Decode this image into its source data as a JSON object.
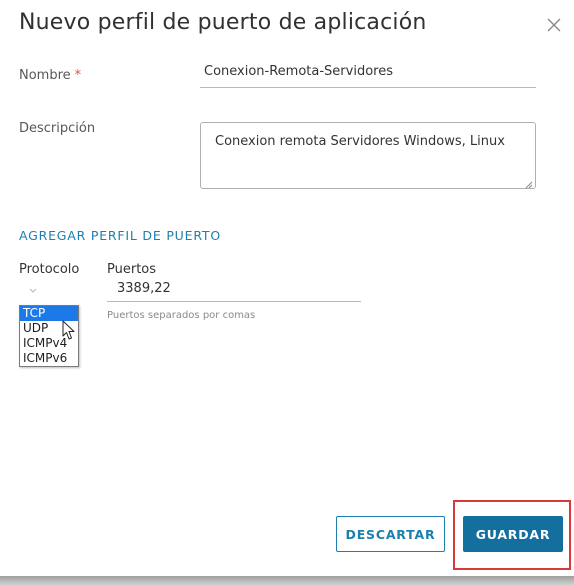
{
  "dialog": {
    "title": "Nuevo perfil de puerto de aplicación",
    "close_icon": "close-icon"
  },
  "form": {
    "name_label": "Nombre",
    "name_required_mark": "*",
    "name_value": "Conexion-Remota-Servidores",
    "description_label": "Descripción",
    "description_value": "Conexion remota Servidores Windows, Linux"
  },
  "port_profile": {
    "section_title": "AGREGAR PERFIL DE PUERTO",
    "protocol_header": "Protocolo",
    "ports_header": "Puertos",
    "ports_value": "3389,22",
    "ports_hint": "Puertos separados por comas",
    "protocol_options": [
      "TCP",
      "UDP",
      "ICMPv4",
      "ICMPv6"
    ],
    "protocol_selected": "TCP"
  },
  "actions": {
    "discard_label": "DESCARTAR",
    "save_label": "GUARDAR"
  },
  "colors": {
    "accent": "#1c7fb0",
    "primary_button": "#156f9e",
    "highlight_box": "#d83a3a",
    "required": "#e05050",
    "selected_option": "#1e79e8"
  }
}
